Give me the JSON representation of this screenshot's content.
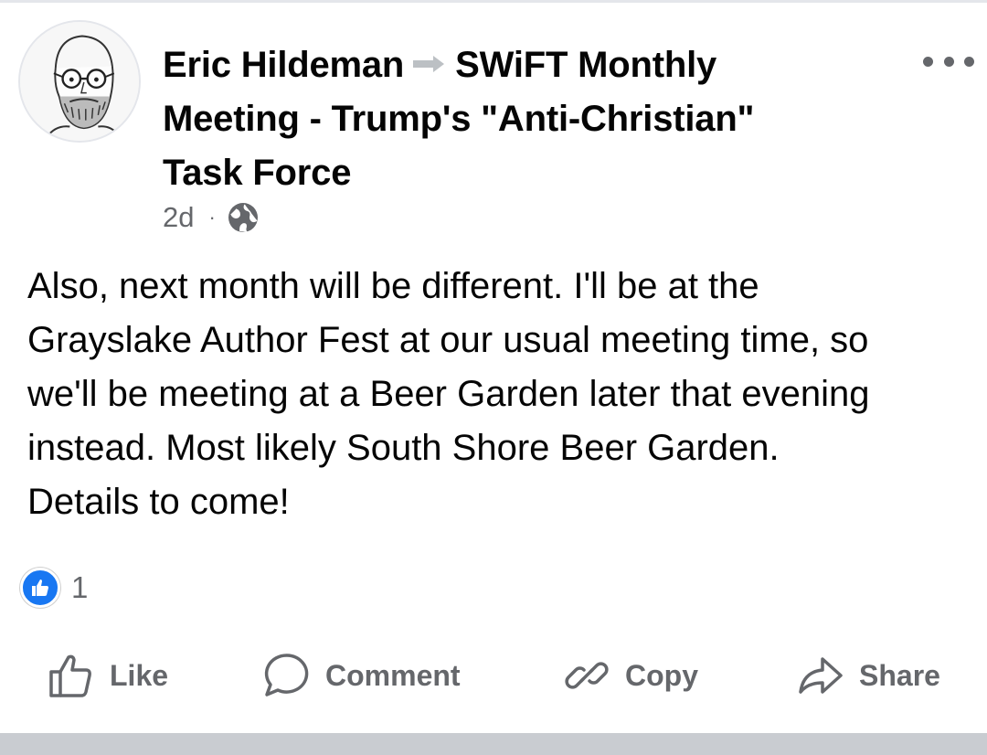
{
  "post": {
    "author": "Eric Hildeman",
    "group": "SWiFT Monthly Meeting - Trump's \"Anti-Christian\" Task Force",
    "timestamp": "2d",
    "separator": "·",
    "audience_icon": "globe-icon",
    "more_icon": "more-options-icon",
    "body": "Also, next month will be different. I'll be at the\nGrayslake Author Fest at our usual meeting time, so\nwe'll be meeting at a Beer Garden later that evening\ninstead. Most likely South Shore Beer Garden.\nDetails to come!"
  },
  "reactions": {
    "icon": "like-reaction-icon",
    "count": "1"
  },
  "actions": {
    "like_label": "Like",
    "comment_label": "Comment",
    "copy_label": "Copy",
    "share_label": "Share"
  },
  "colors": {
    "text": "#050505",
    "secondary": "#65676b",
    "accent": "#1877f2",
    "divider": "#c9ccd1"
  }
}
